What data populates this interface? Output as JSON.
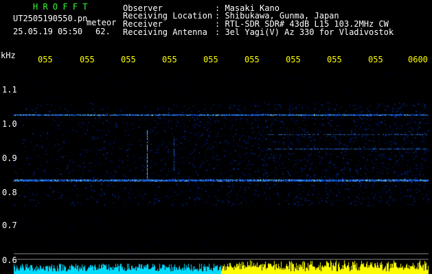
{
  "header": {
    "program": "H R O F F T",
    "filename": "UT2505190550.pn",
    "meteor_label": "meteor",
    "datetime": "25.05.19 05:50",
    "count": "62.",
    "fields": [
      {
        "label": "Observer",
        "value": ": Masaki Kano"
      },
      {
        "label": "Receiving Location",
        "value": ": Shibukawa, Gunma, Japan"
      },
      {
        "label": "Receiver",
        "value": ": RTL-SDR SDR# 43dB L15 103.2MHz CW"
      },
      {
        "label": "Receiving Antenna",
        "value": ": 3el Yagi(V) Az 330 for Vladivostok"
      }
    ]
  },
  "axis": {
    "unit": "kHz",
    "y_ticks": [
      "1.1",
      "1.0",
      "0.9",
      "0.8",
      "0.7",
      "0.6"
    ],
    "x_ticks": [
      "055",
      "055",
      "055",
      "055",
      "055",
      "055",
      "055",
      "055",
      "055",
      "0600"
    ]
  },
  "colors": {
    "text": "#ffffff",
    "title": "#33ff33",
    "time_ticks": "#ffff00",
    "echo": "#3399ff",
    "grid": "#ffffff"
  }
}
